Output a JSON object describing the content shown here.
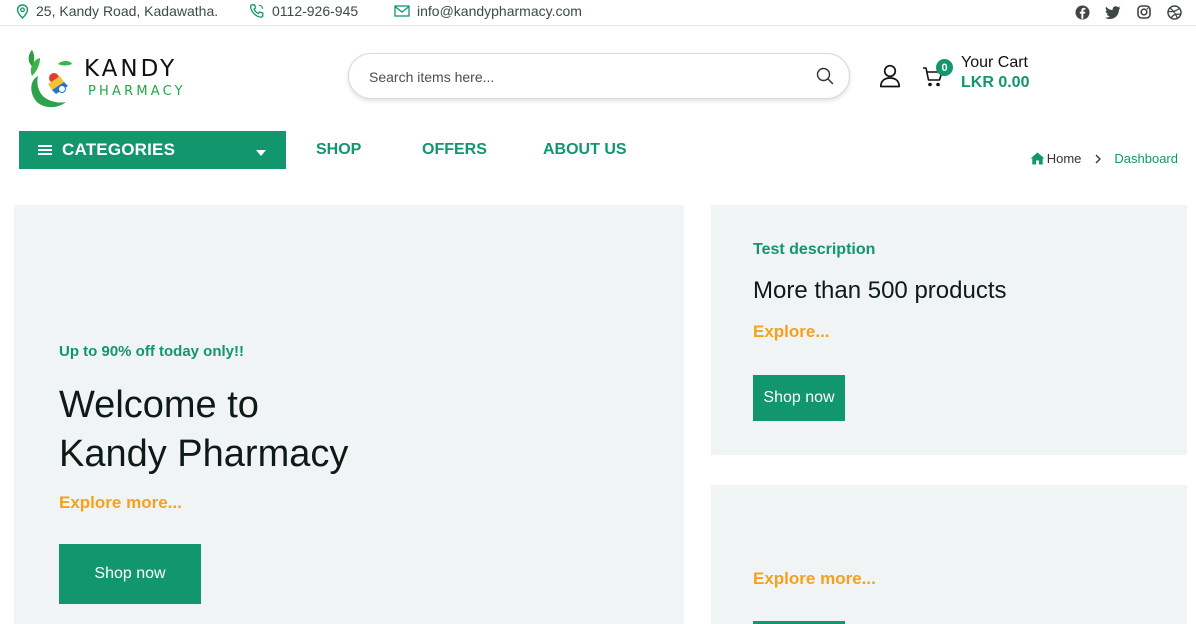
{
  "topbar": {
    "address": "25, Kandy Road, Kadawatha.",
    "phone": "0112-926-945",
    "email": "info@kandypharmacy.com",
    "social_icons": [
      "facebook-icon",
      "twitter-icon",
      "instagram-icon",
      "dribbble-icon"
    ]
  },
  "logo": {
    "line1": "KANDY",
    "line2": "PHARMACY"
  },
  "search": {
    "placeholder": "Search items here..."
  },
  "cart": {
    "count": "0",
    "title": "Your Cart",
    "total": "LKR 0.00"
  },
  "nav": {
    "categories_label": "CATEGORIES",
    "links": [
      "SHOP",
      "OFFERS",
      "ABOUT US"
    ]
  },
  "breadcrumb": {
    "home": "Home",
    "current": "Dashboard"
  },
  "hero": {
    "tagline": "Up to 90% off today only!!",
    "title_line1": "Welcome to",
    "title_line2": "Kandy Pharmacy",
    "explore": "Explore more...",
    "button": "Shop now"
  },
  "promo1": {
    "tagline": "Test description",
    "title": "More than 500 products",
    "explore": "Explore...",
    "button": "Shop now"
  },
  "promo2": {
    "explore": "Explore more..."
  },
  "colors": {
    "brand_green": "#12966b",
    "accent_orange": "#f5a11c",
    "panel_bg": "#f1f4f5"
  }
}
